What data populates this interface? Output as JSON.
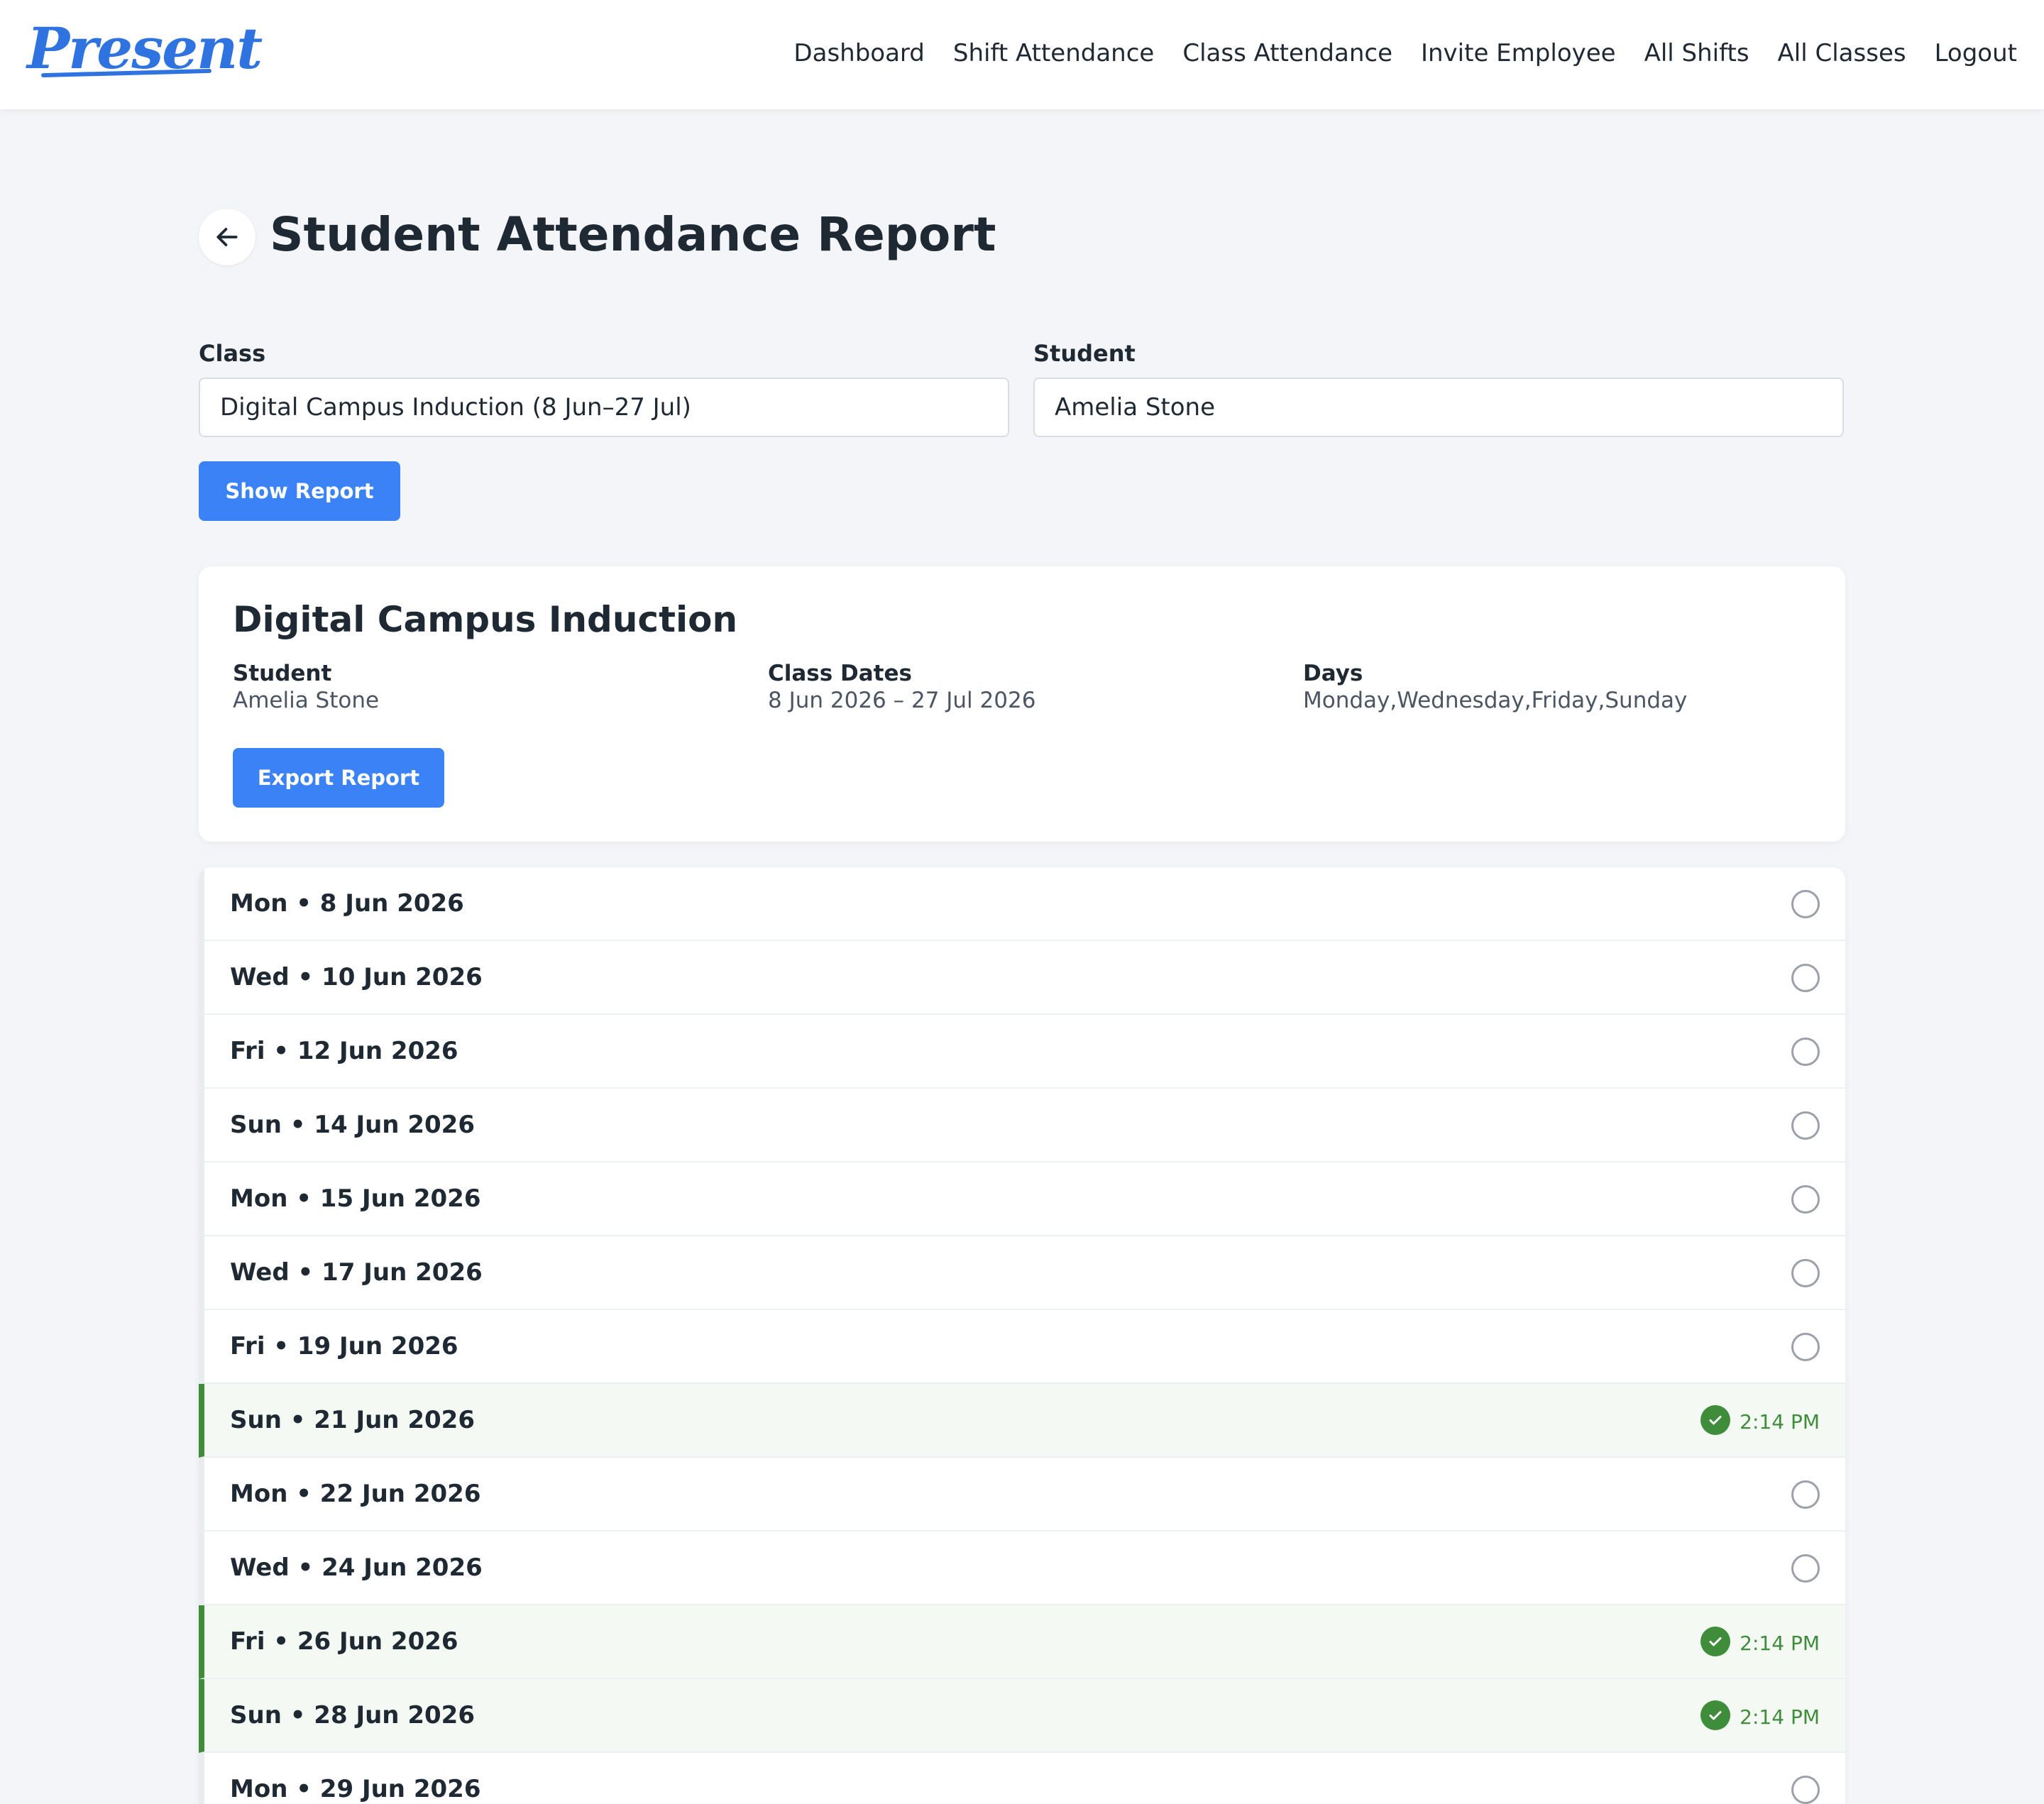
{
  "app": {
    "logo_text": "Present",
    "brand_color": "#2f73e0"
  },
  "nav": {
    "items": [
      {
        "label": "Dashboard"
      },
      {
        "label": "Shift Attendance"
      },
      {
        "label": "Class Attendance"
      },
      {
        "label": "Invite Employee"
      },
      {
        "label": "All Shifts"
      },
      {
        "label": "All Classes"
      },
      {
        "label": "Logout"
      }
    ]
  },
  "header": {
    "back_icon": "arrow-left-icon",
    "title": "Student Attendance Report"
  },
  "filters": {
    "class_label": "Class",
    "class_value": "Digital Campus Induction (8 Jun–27 Jul)",
    "student_label": "Student",
    "student_value": "Amelia Stone",
    "show_report_label": "Show Report"
  },
  "summary": {
    "title": "Digital Campus Induction",
    "student_label": "Student",
    "student_value": "Amelia Stone",
    "dates_label": "Class Dates",
    "dates_value": "8 Jun 2026 – 27 Jul 2026",
    "days_label": "Days",
    "days_value": "Monday,Wednesday,Friday,Sunday",
    "export_label": "Export Report"
  },
  "colors": {
    "accent": "#3b82f6",
    "present_green": "#3f8d3a",
    "present_row_bg": "#f4faf3"
  },
  "sessions": [
    {
      "date": "Mon • 8 Jun 2026",
      "present": false,
      "time": ""
    },
    {
      "date": "Wed • 10 Jun 2026",
      "present": false,
      "time": ""
    },
    {
      "date": "Fri • 12 Jun 2026",
      "present": false,
      "time": ""
    },
    {
      "date": "Sun • 14 Jun 2026",
      "present": false,
      "time": ""
    },
    {
      "date": "Mon • 15 Jun 2026",
      "present": false,
      "time": ""
    },
    {
      "date": "Wed • 17 Jun 2026",
      "present": false,
      "time": ""
    },
    {
      "date": "Fri • 19 Jun 2026",
      "present": false,
      "time": ""
    },
    {
      "date": "Sun • 21 Jun 2026",
      "present": true,
      "time": "2:14 PM"
    },
    {
      "date": "Mon • 22 Jun 2026",
      "present": false,
      "time": ""
    },
    {
      "date": "Wed • 24 Jun 2026",
      "present": false,
      "time": ""
    },
    {
      "date": "Fri • 26 Jun 2026",
      "present": true,
      "time": "2:14 PM"
    },
    {
      "date": "Sun • 28 Jun 2026",
      "present": true,
      "time": "2:14 PM"
    },
    {
      "date": "Mon • 29 Jun 2026",
      "present": false,
      "time": ""
    }
  ]
}
